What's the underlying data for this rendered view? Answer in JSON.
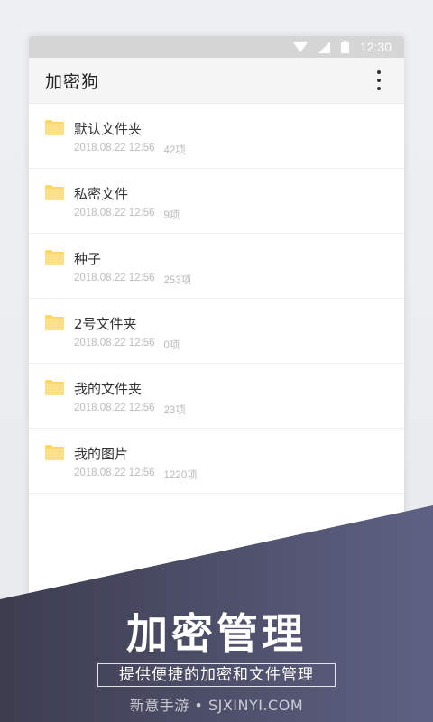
{
  "status_bar": {
    "time": "12:30",
    "icons": [
      "wifi-icon",
      "signal-icon",
      "battery-icon"
    ]
  },
  "app_bar": {
    "title": "加密狗",
    "menu_icon": "more-vert-icon"
  },
  "folders": [
    {
      "name": "默认文件夹",
      "date": "2018.08.22 12:56",
      "count": "42项"
    },
    {
      "name": "私密文件",
      "date": "2018.08.22 12:56",
      "count": "9项"
    },
    {
      "name": "种子",
      "date": "2018.08.22 12:56",
      "count": "253项"
    },
    {
      "name": "2号文件夹",
      "date": "2018.08.22 12:56",
      "count": "0项"
    },
    {
      "name": "我的文件夹",
      "date": "2018.08.22 12:56",
      "count": "23项"
    },
    {
      "name": "我的图片",
      "date": "2018.08.22 12:56",
      "count": "1220项"
    }
  ],
  "banner": {
    "title": "加密管理",
    "subtitle": "提供便捷的加密和文件管理",
    "watermark": "新意手游 • SJXINYI.COM"
  },
  "colors": {
    "folder": "#fdd76a",
    "banner_dark": "#3c3d4f",
    "banner_light": "#5f6184"
  }
}
